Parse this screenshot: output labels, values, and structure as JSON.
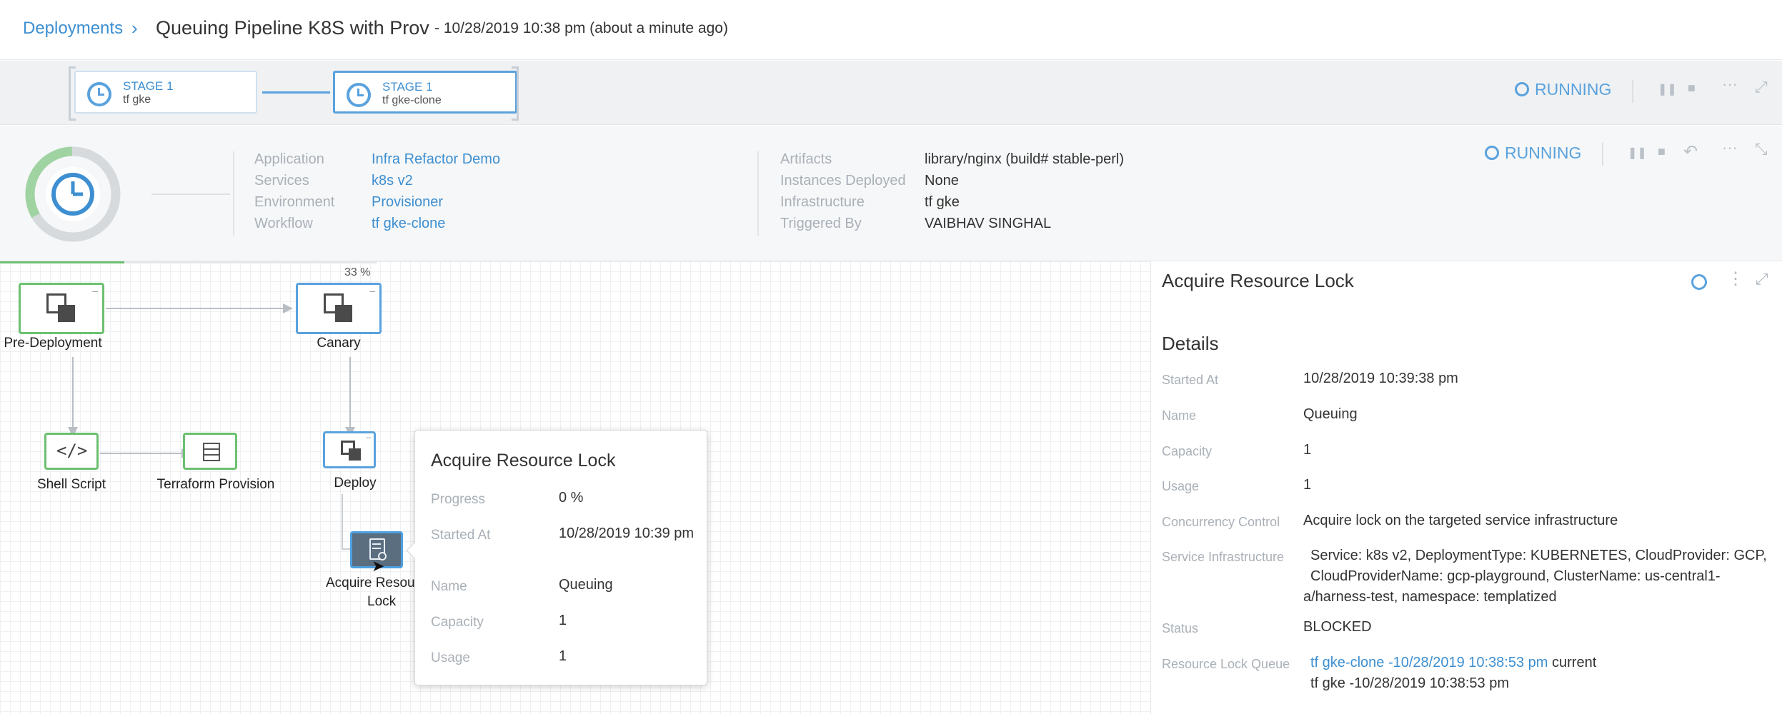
{
  "header": {
    "breadcrumb": "Deployments",
    "title": "Queuing Pipeline K8S with Prov",
    "subtitle": "- 10/28/2019 10:38 pm (about a minute ago)"
  },
  "stages": [
    {
      "label": "STAGE 1",
      "name": "tf gke"
    },
    {
      "label": "STAGE 1",
      "name": "tf gke-clone"
    }
  ],
  "pipeline_status": "RUNNING",
  "workflow_status": "RUNNING",
  "progress_ring": {
    "fraction": 0.33
  },
  "info_left": [
    {
      "label": "Application",
      "value": "Infra Refactor Demo"
    },
    {
      "label": "Services",
      "value": "k8s v2"
    },
    {
      "label": "Environment",
      "value": "Provisioner"
    },
    {
      "label": "Workflow",
      "value": "tf gke-clone"
    }
  ],
  "info_right": [
    {
      "label": "Artifacts",
      "value": "library/nginx (build# stable-perl)"
    },
    {
      "label": "Instances Deployed",
      "value": "None"
    },
    {
      "label": "Infrastructure",
      "value": "tf gke"
    },
    {
      "label": "Triggered By",
      "value": "VAIBHAV SINGHAL"
    }
  ],
  "graph": {
    "progress_label": "33 %",
    "progress_fraction": 0.33,
    "nodes": {
      "pre_deployment": "Pre-Deployment",
      "canary": "Canary",
      "shell_script": "Shell Script",
      "terraform": "Terraform Provision",
      "deploy": "Deploy",
      "acquire_line1": "Acquire Resou",
      "acquire_line2": "Lock"
    }
  },
  "popup": {
    "title": "Acquire Resource Lock",
    "rows": [
      {
        "label": "Progress",
        "value": "0 %"
      },
      {
        "label": "Started At",
        "value": "10/28/2019 10:39 pm"
      },
      {
        "label": "Name",
        "value": "Queuing"
      },
      {
        "label": "Capacity",
        "value": "1"
      },
      {
        "label": "Usage",
        "value": "1"
      }
    ]
  },
  "panel": {
    "title": "Acquire Resource Lock",
    "details_heading": "Details",
    "rows": {
      "started_at": {
        "label": "Started At",
        "value": "10/28/2019 10:39:38 pm"
      },
      "name": {
        "label": "Name",
        "value": "Queuing"
      },
      "capacity": {
        "label": "Capacity",
        "value": "1"
      },
      "usage": {
        "label": "Usage",
        "value": "1"
      },
      "concurrency": {
        "label": "Concurrency Control",
        "value": "Acquire lock on the targeted service infrastructure"
      },
      "service_infra": {
        "label": "Service Infrastructure",
        "line1": "Service: k8s v2, DeploymentType: KUBERNETES, CloudProvider: GCP,",
        "line2": "CloudProviderName: gcp-playground, ClusterName: us-central1-",
        "line3": "a/harness-test, namespace: templatized"
      },
      "status": {
        "label": "Status",
        "value": "BLOCKED"
      },
      "queue": {
        "label": "Resource Lock Queue",
        "item1_link": "tf gke-clone -10/28/2019 10:38:53 pm",
        "item1_suffix": "current",
        "item2_link": "tf gke -10/28/2019 10:38:53 pm"
      }
    }
  },
  "colors": {
    "accent": "#3d8fd1",
    "success": "#6cc070",
    "running": "#5aa2dd"
  }
}
